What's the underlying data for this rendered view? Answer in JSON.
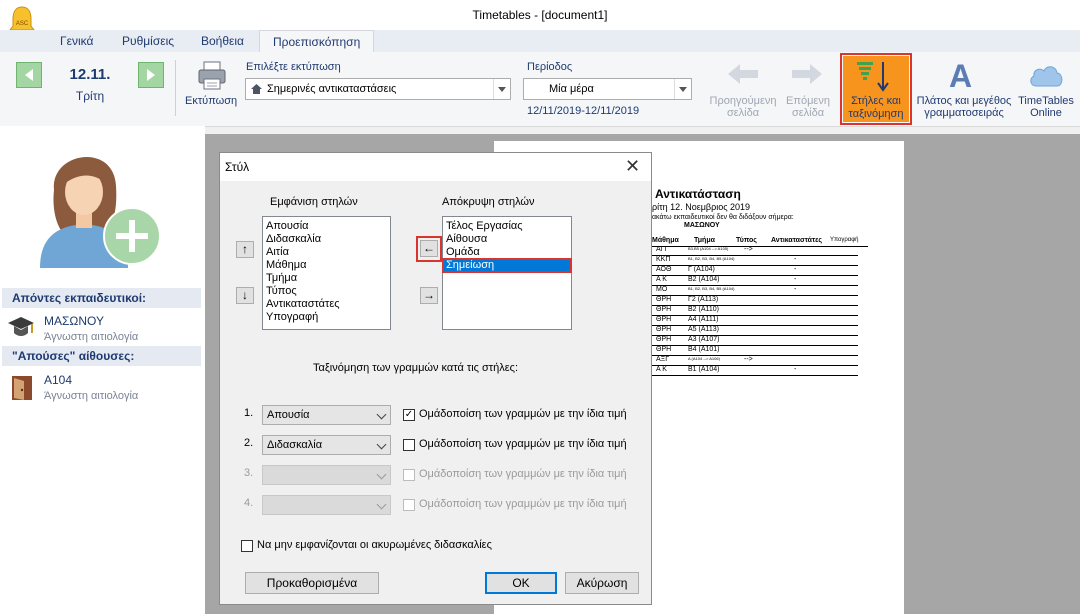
{
  "window": {
    "title": "Timetables - [document1]"
  },
  "app_logo": {
    "text": "ASC",
    "icon": "bell-icon"
  },
  "tabs": [
    {
      "label": "Γενικά"
    },
    {
      "label": "Ρυθμίσεις"
    },
    {
      "label": "Βοήθεια"
    },
    {
      "label": "Προεπισκόπηση",
      "active": true
    }
  ],
  "ribbon": {
    "date": "12.11.",
    "weekday": "Τρίτη",
    "print_label": "Εκτύπωση",
    "choose_print_label": "Επιλέξτε εκτύπωση",
    "choose_print_value": "Σημερινές αντικαταστάσεις",
    "period_label": "Περίοδος",
    "period_value": "Μία μέρα",
    "period_range": "12/11/2019-12/11/2019",
    "prev_page": "Προηγούμενη σελίδα",
    "prev_page_l1": "Προηγούμενη",
    "prev_page_l2": "σελίδα",
    "next_page_l1": "Επόμενη",
    "next_page_l2": "σελίδα",
    "columns_sort_l1": "Στήλες και",
    "columns_sort_l2": "ταξινόμηση",
    "font_l1": "Πλάτος και μεγέθος",
    "font_l2": "γραμματοσειράς",
    "online_l1": "TimeTables",
    "online_l2": "Online",
    "accent": "#f7941d",
    "highlight": "#d9352e"
  },
  "left": {
    "absent_teachers_header": "Απόντες εκπαιδευτικοί:",
    "teacher_name": "ΜΑΣΩΝΟΥ",
    "teacher_reason": "Άγνωστη αιτιολογία",
    "absent_rooms_header": "\"Απούσες\" αίθουσες:",
    "room_name": "Α104",
    "room_reason": "Άγνωστη αιτιολογία"
  },
  "dialog": {
    "title": "Στύλ",
    "show_columns_label": "Εμφάνιση στηλών",
    "hide_columns_label": "Απόκρυψη στηλών",
    "show_columns": [
      "Απουσία",
      "Διδασκαλία",
      "Αιτία",
      "Μάθημα",
      "Τμήμα",
      "Τύπος",
      "Αντικαταστάτες",
      "Υπογραφή"
    ],
    "hide_columns": [
      "Τέλος Εργασίας",
      "Αίθουσα",
      "Ομάδα",
      "Σημείωση"
    ],
    "selected_hidden": "Σημείωση",
    "sort_label": "Ταξινόμηση των γραμμών κατά τις στήλες:",
    "sort_rows": [
      {
        "num": "1.",
        "value": "Απουσία",
        "check_label": "Ομάδοποίση των γραμμών με την ίδια τιμή",
        "checked": true,
        "enabled": true
      },
      {
        "num": "2.",
        "value": "Διδασκαλία",
        "check_label": "Ομάδοποίση των γραμμών με την ίδια τιμή",
        "checked": false,
        "enabled": true
      },
      {
        "num": "3.",
        "value": "",
        "check_label": "Ομάδοποίση των γραμμών με την ίδια τιμή",
        "checked": false,
        "enabled": false
      },
      {
        "num": "4.",
        "value": "",
        "check_label": "Ομάδοποίση των γραμμών με την ίδια τιμή",
        "checked": false,
        "enabled": false
      }
    ],
    "hide_cancelled_label": "Να μην εμφανίζονται οι ακυρωμένες διδασκαλίες",
    "defaults_button": "Προκαθορισμένα",
    "ok_button": "ΟΚ",
    "cancel_button": "Ακύρωση"
  },
  "doc": {
    "title": "Αντικατάσταση",
    "subtitle": "ρίτη 12. Νοεμβριος 2019",
    "note": "ακάτω εκπαιδευτικοί δεν θα διδάξουν σήμερα:",
    "teacher": "ΜΑΣΩΝΟΥ",
    "headers": [
      "Μάθημα",
      "Τμήμα",
      "Τύπος",
      "Αντικαταστάτες",
      "Υπογραφή"
    ],
    "rows": [
      {
        "subject": "ΑΓΓ",
        "class": "Β3,Β5 (Α104 --> Α105)",
        "type": "-->",
        "sub": ""
      },
      {
        "subject": "ΚΚΠ",
        "class": "Β1, Β2, Β3, Β4, Β5 (Α104)",
        "type": "",
        "sub": "-"
      },
      {
        "subject": "ΑΟΘ",
        "class": "Γ (Α104)",
        "type": "",
        "sub": "-"
      },
      {
        "subject": "Α Κ",
        "class": "Β2 (Α104)",
        "type": "",
        "sub": "-"
      },
      {
        "subject": "ΜΟ",
        "class": "Β1, Β2, Β3, Β4, Β5 (Α104)",
        "type": "",
        "sub": "-"
      },
      {
        "subject": "ΘΡΗ",
        "class": "Γ2 (Α113)",
        "type": "",
        "sub": ""
      },
      {
        "subject": "ΘΡΗ",
        "class": "Β2 (Α110)",
        "type": "",
        "sub": ""
      },
      {
        "subject": "ΘΡΗ",
        "class": "Α4 (Α111)",
        "type": "",
        "sub": ""
      },
      {
        "subject": "ΘΡΗ",
        "class": "Α5 (Α113)",
        "type": "",
        "sub": ""
      },
      {
        "subject": "ΘΡΗ",
        "class": "Α3 (Α107)",
        "type": "",
        "sub": ""
      },
      {
        "subject": "ΘΡΗ",
        "class": "Β4 (Α101)",
        "type": "",
        "sub": ""
      },
      {
        "subject": "ΑΞΓ",
        "class": "Α (Α104 --> Α106)",
        "type": "-->",
        "sub": ""
      },
      {
        "subject": "Α Κ",
        "class": "Β1 (Α104)",
        "type": "",
        "sub": "-"
      }
    ]
  }
}
